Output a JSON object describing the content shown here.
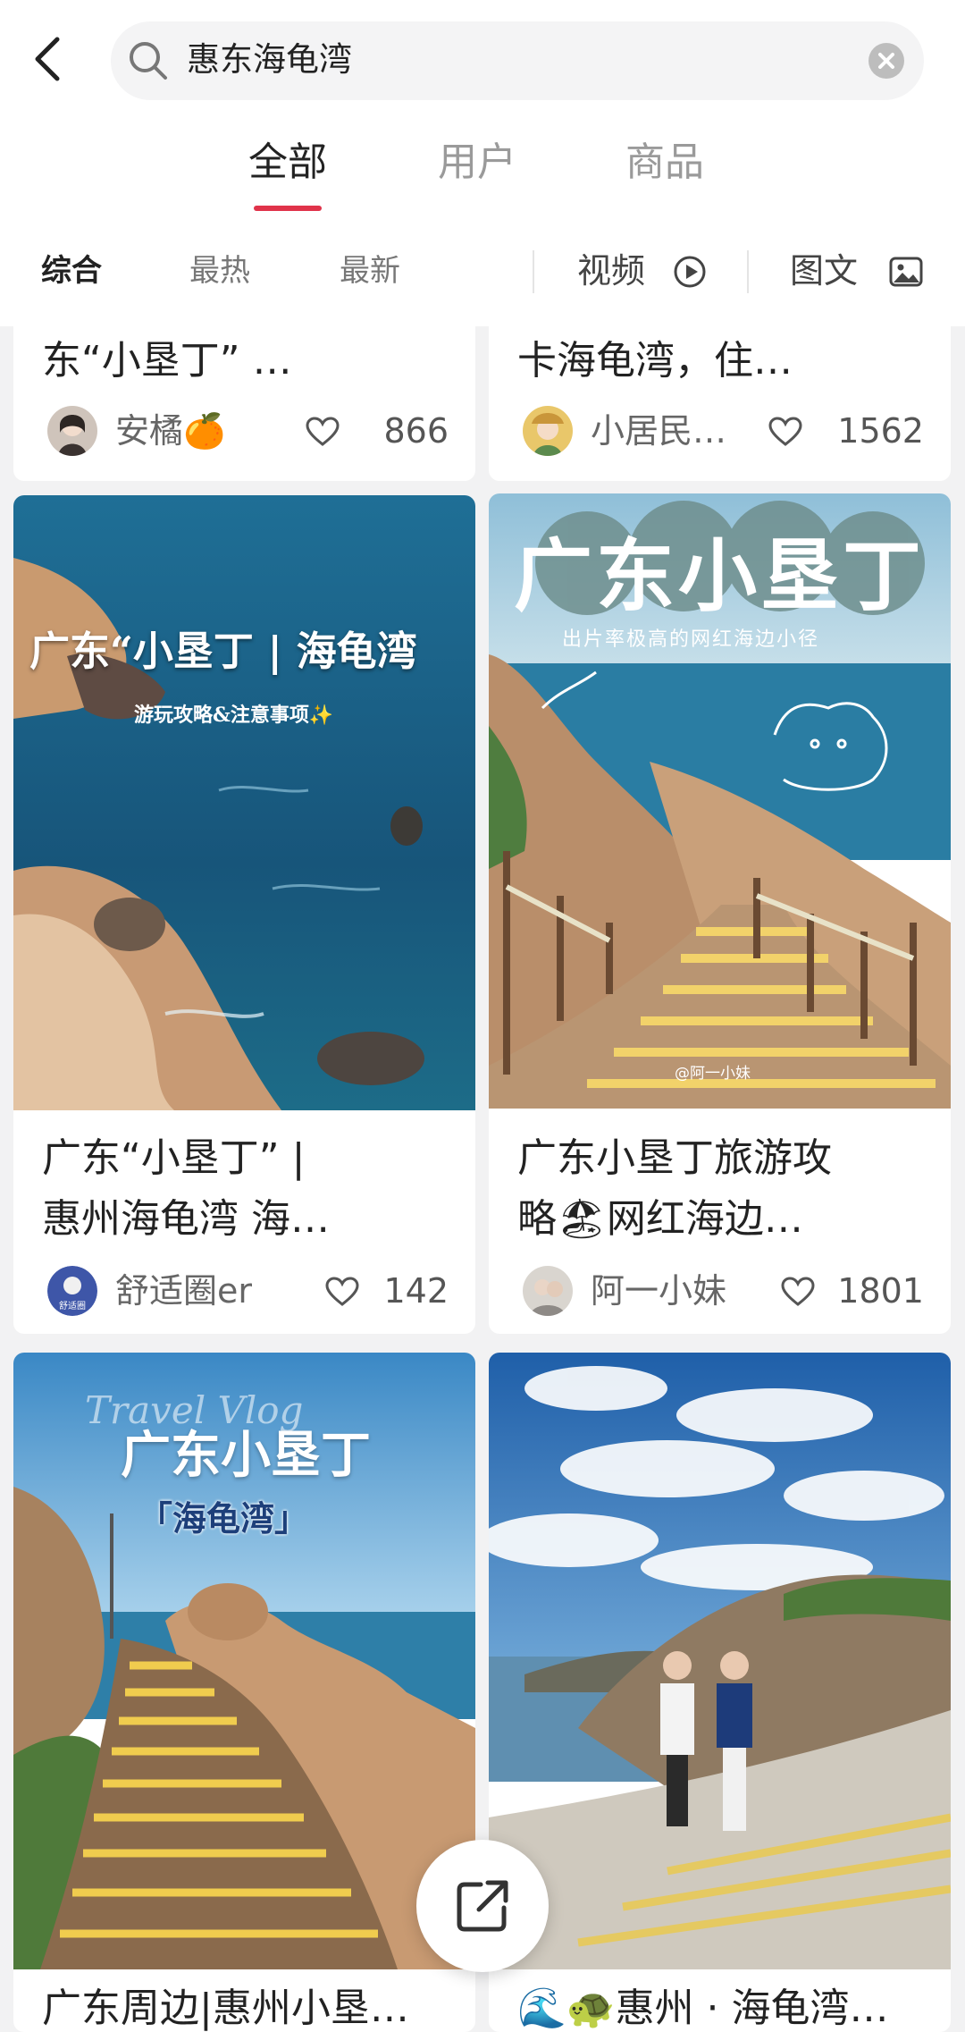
{
  "search": {
    "query": "惠东海龟湾"
  },
  "tabs": [
    "全部",
    "用户",
    "商品"
  ],
  "filters": {
    "items": [
      "综合",
      "最热",
      "最新"
    ],
    "video": "视频",
    "image_text": "图文"
  },
  "cards": [
    {
      "title": "东“小垦丁” …",
      "author": "安橘🍊",
      "likes": "866"
    },
    {
      "title": "卡海龟湾，住…",
      "author": "小居民…",
      "likes": "1562"
    },
    {
      "title_line1": "广东“小垦丁” |",
      "title_line2": "惠州海龟湾 海…",
      "author": "舒适圈er",
      "likes": "142",
      "img_title": "广东“小垦丁 | 海龟湾",
      "img_sub": "游玩攻略&注意事项✨",
      "avatar_text": "舒适圈"
    },
    {
      "title_line1": "广东小垦丁旅游攻",
      "title_line2": "略🏖网红海边…",
      "author": "阿一小妹",
      "likes": "1801",
      "img_title": "广东小垦丁",
      "img_sub": "出片率极高的网红海边小径",
      "watermark": "@阿一小妹"
    },
    {
      "title": "广东周边|惠州小垦…",
      "img_title": "广东小垦丁",
      "img_sub": "「海龟湾」",
      "img_script": "Travel Vlog"
    },
    {
      "title": "🌊🐢惠州 · 海龟湾…"
    }
  ],
  "icons": {
    "back": "chevron-left-icon",
    "search": "search-icon",
    "clear": "clear-icon",
    "video": "play-icon",
    "image": "image-icon",
    "heart": "heart-icon",
    "share": "share-icon"
  },
  "colors": {
    "accent": "#e0334a"
  }
}
